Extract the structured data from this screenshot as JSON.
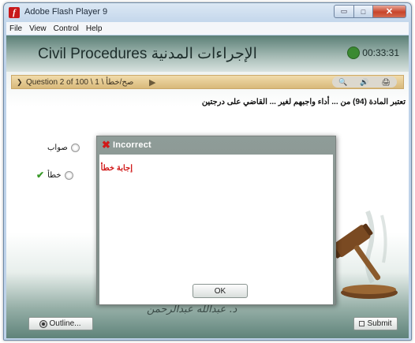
{
  "window": {
    "title": "Adobe Flash Player 9",
    "controls": {
      "minimize": "▭",
      "maximize": "□",
      "close": "✕"
    }
  },
  "menu": [
    "File",
    "View",
    "Control",
    "Help"
  ],
  "header": {
    "course_title": "Civil Procedures الإجراءات المدنية",
    "timer": "00:33:31"
  },
  "nav": {
    "question_label": "Question 2 of 100 \\ 1 \\ صح/خطأ",
    "tools": [
      "🔍",
      "🔊",
      "🖨"
    ]
  },
  "question": {
    "text": "تعتبر المادة (94) من ... أداء واجبهم لغير ... القاضي على درجتين"
  },
  "options": [
    {
      "label": "صواب"
    },
    {
      "label": "خطأ"
    }
  ],
  "signature": "د. عبدالله عبدالرحمن",
  "buttons": {
    "outline": "Outline...",
    "submit": "Submit"
  },
  "dialog": {
    "title": "Incorrect",
    "message": "إجابة خطأ",
    "ok": "OK"
  },
  "colors": {
    "accent_error": "#d11a1a",
    "timer_green": "#3b8a32",
    "nav_band": "#e4c68a"
  }
}
